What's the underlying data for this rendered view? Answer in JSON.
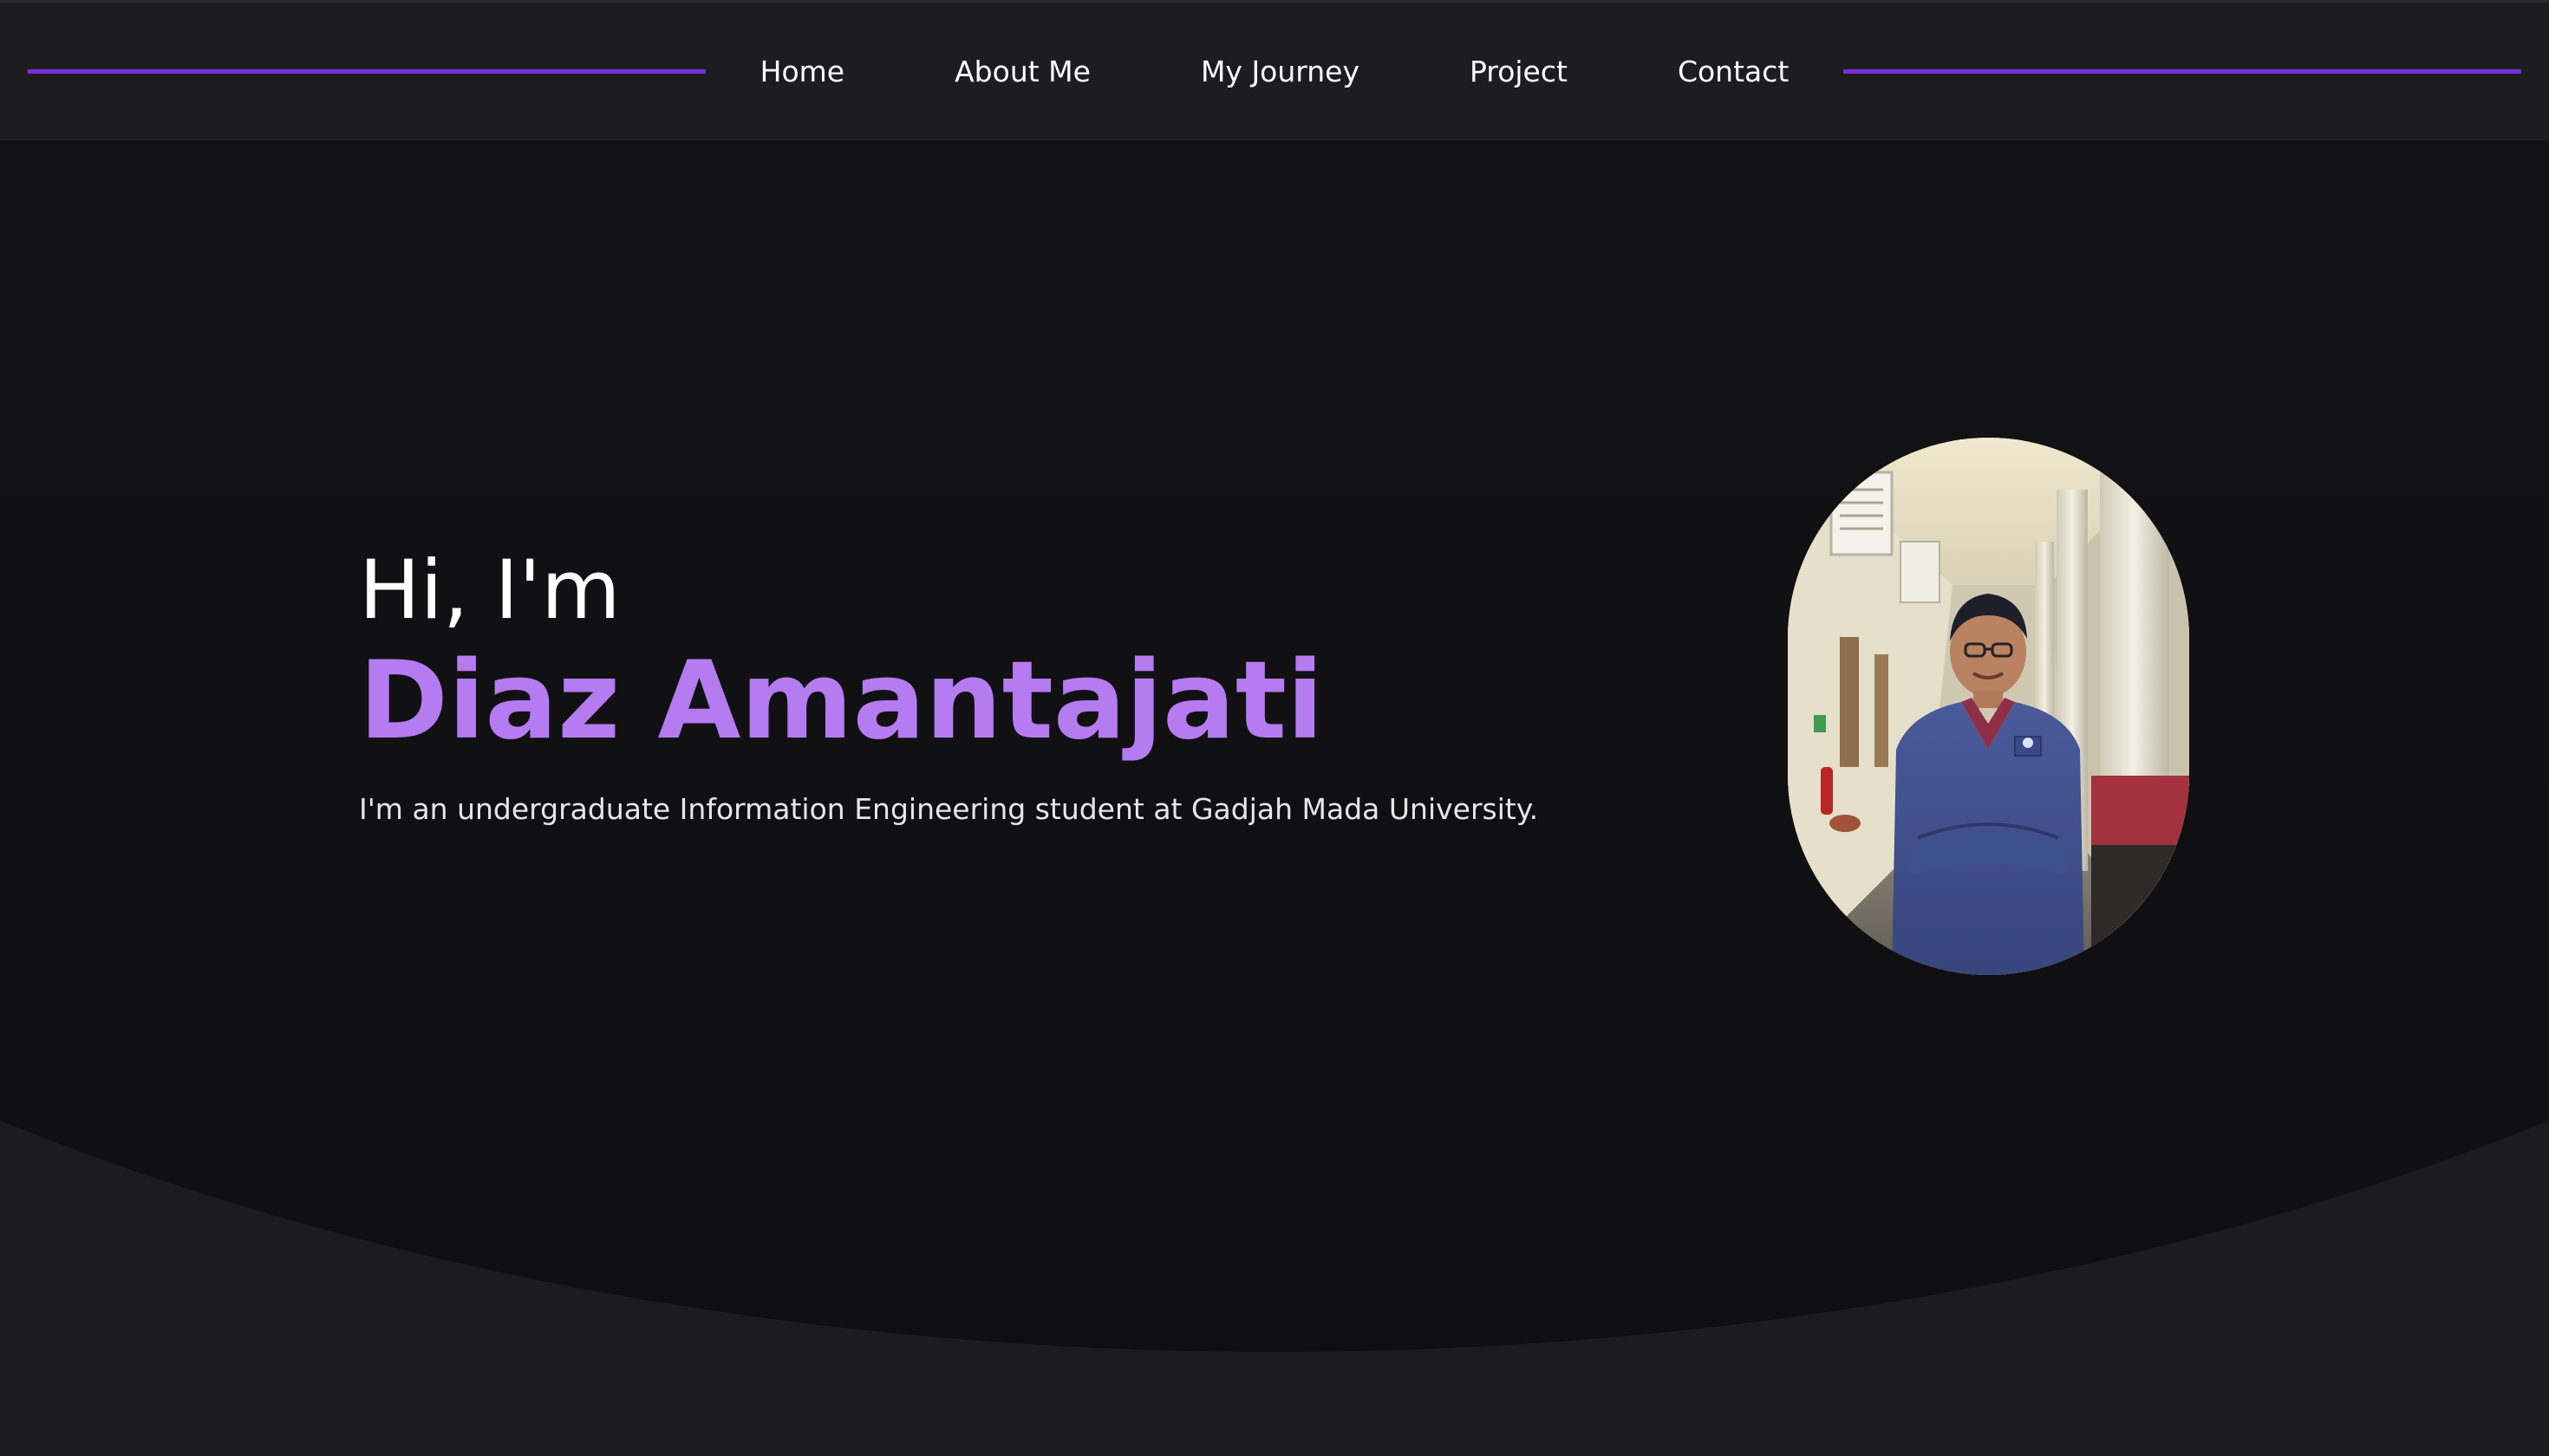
{
  "nav": {
    "items": [
      {
        "label": "Home"
      },
      {
        "label": "About Me"
      },
      {
        "label": "My Journey"
      },
      {
        "label": "Project"
      },
      {
        "label": "Contact"
      }
    ],
    "accent_color": "#7a2ee0"
  },
  "hero": {
    "greeting": "Hi, I'm",
    "name": "Diaz Amantajati",
    "tagline": "I'm an undergraduate Information Engineering student at Gadjah Mada University.",
    "name_color": "#b57bf0"
  },
  "portrait": {
    "alt": "Portrait photo",
    "icon": "portrait-photo"
  }
}
